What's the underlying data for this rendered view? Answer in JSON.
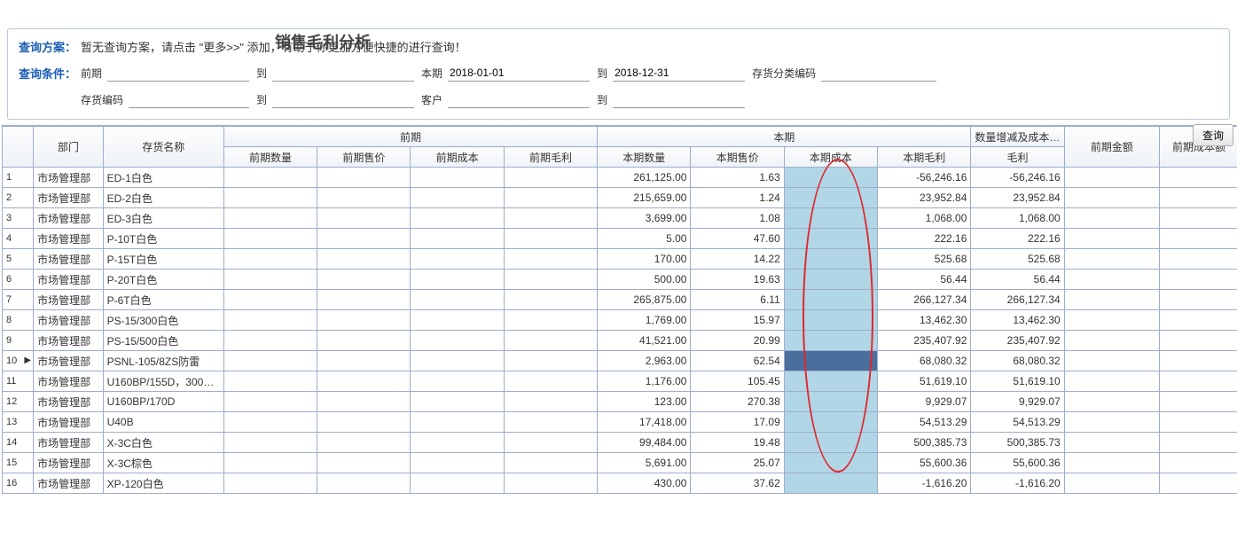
{
  "title": "销售毛利分析",
  "scheme": {
    "label": "查询方案：",
    "tip": "暂无查询方案，请点击 \"更多>>\" 添加，有助于你更加方便快捷的进行查询！"
  },
  "cond": {
    "label": "查询条件：",
    "row1": {
      "prev_label": "前期",
      "prev_val": "",
      "to1_label": "到",
      "to1_val": "",
      "curr_label": "本期",
      "curr_val": "2018-01-01",
      "to2_label": "到",
      "to2_val": "2018-12-31",
      "cat_label": "存货分类编码",
      "cat_val": ""
    },
    "row2": {
      "inv_label": "存货编码",
      "inv_val": "",
      "to3_label": "到",
      "to3_val": "",
      "cust_label": "客户",
      "cust_val": "",
      "to4_label": "到",
      "to4_val": ""
    }
  },
  "btn_query": "查询",
  "headers": {
    "dept": "部门",
    "name": "存货名称",
    "prev_group": "前期",
    "prev_qty": "前期数量",
    "prev_price": "前期售价",
    "prev_cost": "前期成本",
    "prev_gp": "前期毛利",
    "curr_group": "本期",
    "curr_qty": "本期数量",
    "curr_price": "本期售价",
    "curr_cost": "本期成本",
    "curr_gp": "本期毛利",
    "delta_group": "数量增减及成本影响",
    "delta_gp": "毛利",
    "prev_amt": "前期金额",
    "prev_cost_amt": "前期成本额"
  },
  "rows": [
    {
      "n": "1",
      "dept": "市场管理部",
      "name": "ED-1白色",
      "cq": "261,125.00",
      "cp": "1.63",
      "cg": "-56,246.16",
      "dg": "-56,246.16"
    },
    {
      "n": "2",
      "dept": "市场管理部",
      "name": "ED-2白色",
      "cq": "215,659.00",
      "cp": "1.24",
      "cg": "23,952.84",
      "dg": "23,952.84"
    },
    {
      "n": "3",
      "dept": "市场管理部",
      "name": "ED-3白色",
      "cq": "3,699.00",
      "cp": "1.08",
      "cg": "1,068.00",
      "dg": "1,068.00"
    },
    {
      "n": "4",
      "dept": "市场管理部",
      "name": "P-10T白色",
      "cq": "5.00",
      "cp": "47.60",
      "cg": "222.16",
      "dg": "222.16"
    },
    {
      "n": "5",
      "dept": "市场管理部",
      "name": "P-15T白色",
      "cq": "170.00",
      "cp": "14.22",
      "cg": "525.68",
      "dg": "525.68"
    },
    {
      "n": "6",
      "dept": "市场管理部",
      "name": "P-20T白色",
      "cq": "500.00",
      "cp": "19.63",
      "cg": "56.44",
      "dg": "56.44"
    },
    {
      "n": "7",
      "dept": "市场管理部",
      "name": "P-6T白色",
      "cq": "265,875.00",
      "cp": "6.11",
      "cg": "266,127.34",
      "dg": "266,127.34"
    },
    {
      "n": "8",
      "dept": "市场管理部",
      "name": "PS-15/300白色",
      "cq": "1,769.00",
      "cp": "15.97",
      "cg": "13,462.30",
      "dg": "13,462.30"
    },
    {
      "n": "9",
      "dept": "市场管理部",
      "name": "PS-15/500白色",
      "cq": "41,521.00",
      "cp": "20.99",
      "cg": "235,407.92",
      "dg": "235,407.92"
    },
    {
      "n": "10",
      "dept": "市场管理部",
      "name": "PSNL-105/8ZS防雷",
      "cq": "2,963.00",
      "cp": "62.54",
      "cg": "68,080.32",
      "dg": "68,080.32",
      "sel": true
    },
    {
      "n": "11",
      "dept": "市场管理部",
      "name": "U160BP/155D，300，…",
      "cq": "1,176.00",
      "cp": "105.45",
      "cg": "51,619.10",
      "dg": "51,619.10"
    },
    {
      "n": "12",
      "dept": "市场管理部",
      "name": "U160BP/170D",
      "cq": "123.00",
      "cp": "270.38",
      "cg": "9,929.07",
      "dg": "9,929.07"
    },
    {
      "n": "13",
      "dept": "市场管理部",
      "name": "U40B",
      "cq": "17,418.00",
      "cp": "17.09",
      "cg": "54,513.29",
      "dg": "54,513.29"
    },
    {
      "n": "14",
      "dept": "市场管理部",
      "name": "X-3C白色",
      "cq": "99,484.00",
      "cp": "19.48",
      "cg": "500,385.73",
      "dg": "500,385.73"
    },
    {
      "n": "15",
      "dept": "市场管理部",
      "name": "X-3C棕色",
      "cq": "5,691.00",
      "cp": "25.07",
      "cg": "55,600.36",
      "dg": "55,600.36"
    },
    {
      "n": "16",
      "dept": "市场管理部",
      "name": "XP-120白色",
      "cq": "430.00",
      "cp": "37.62",
      "cg": "-1,616.20",
      "dg": "-1,616.20"
    }
  ]
}
